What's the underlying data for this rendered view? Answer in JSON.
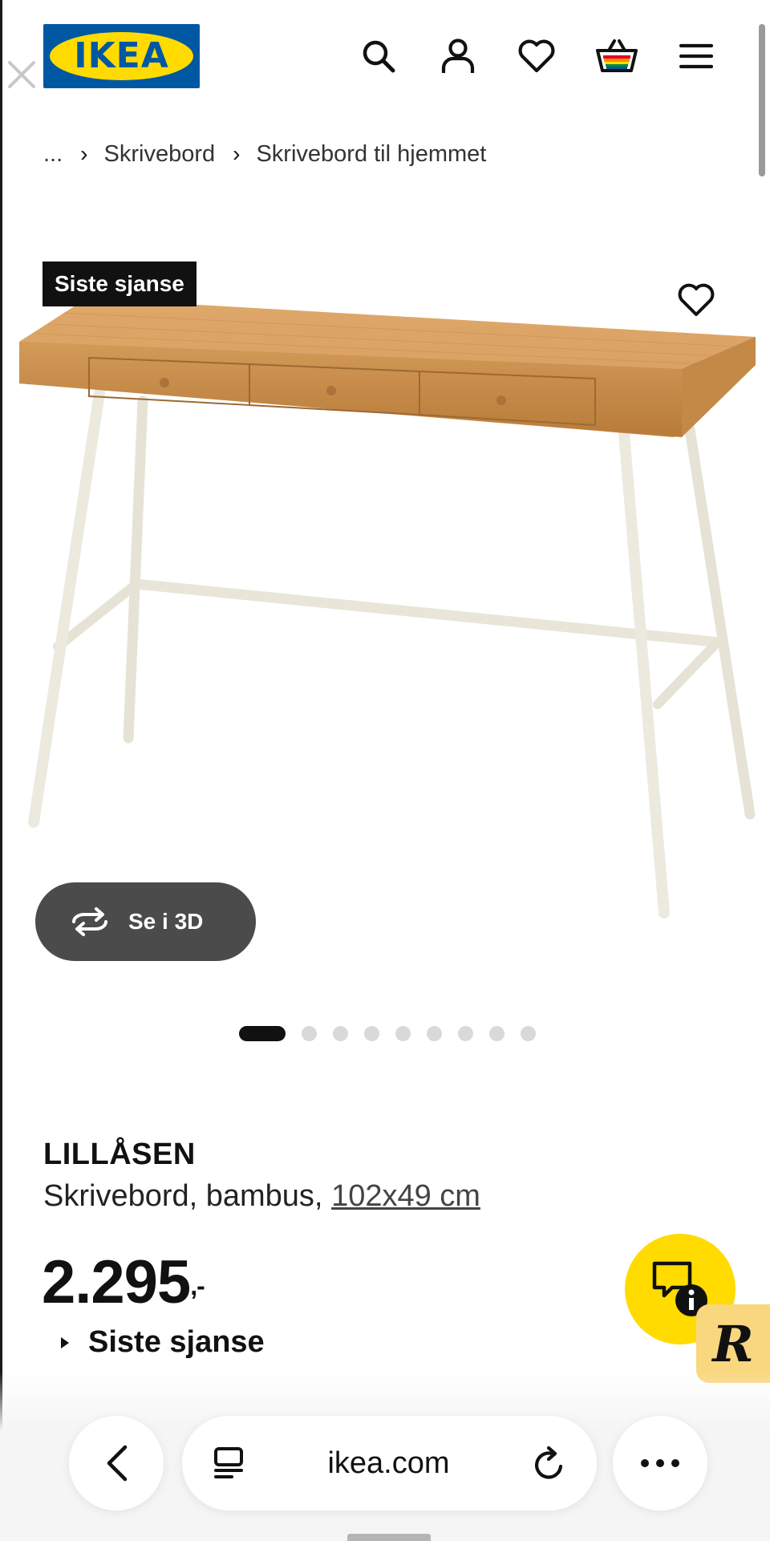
{
  "header": {
    "logo_text": "IKEA",
    "icons": [
      "search-icon",
      "user-icon",
      "heart-icon",
      "basket-icon",
      "menu-icon"
    ]
  },
  "breadcrumb": {
    "items": [
      "...",
      "Skrivebord",
      "Skrivebord til hjemmet"
    ]
  },
  "gallery": {
    "badge": "Siste sjanse",
    "view3d_label": "Se i 3D",
    "image_count": 9,
    "active_index": 0
  },
  "product": {
    "name": "LILLÅSEN",
    "description": "Skrivebord, bambus,",
    "dimensions": "102x49 cm",
    "price": "2.295",
    "price_suffix": ",-",
    "status_label": "Siste sjanse"
  },
  "browser": {
    "url": "ikea.com"
  },
  "colors": {
    "brand_blue": "#0058a3",
    "brand_yellow": "#ffdb00",
    "badge_bg": "#111111",
    "view3d_bg": "#4b4b4b"
  }
}
